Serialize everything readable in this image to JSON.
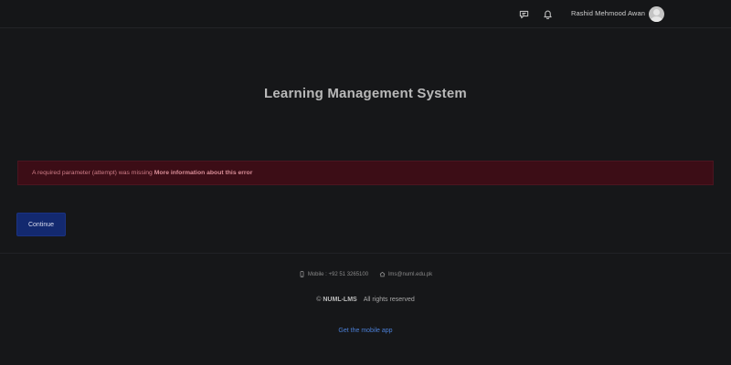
{
  "header": {
    "user_name": "Rashid Mehmood Awan"
  },
  "main": {
    "title": "Learning Management System",
    "error_message": "A required parameter (attempt) was missing",
    "error_link": "More information about this error",
    "continue_label": "Continue"
  },
  "footer": {
    "mobile": "Mobile : +92 51 3265100",
    "email": "lms@numl.edu.pk",
    "copyright_symbol": "©",
    "brand": "NUML-LMS",
    "rights": "All rights reserved",
    "mobile_app_link": "Get the mobile app"
  },
  "colors": {
    "background": "#161719",
    "alert_bg": "#3c0d16",
    "alert_text": "#cf7d88",
    "primary_button": "#13296f",
    "link": "#4b7fd6"
  },
  "icons": [
    "messages-icon",
    "bell-icon",
    "avatar-icon",
    "mobile-phone-icon",
    "home-icon"
  ]
}
